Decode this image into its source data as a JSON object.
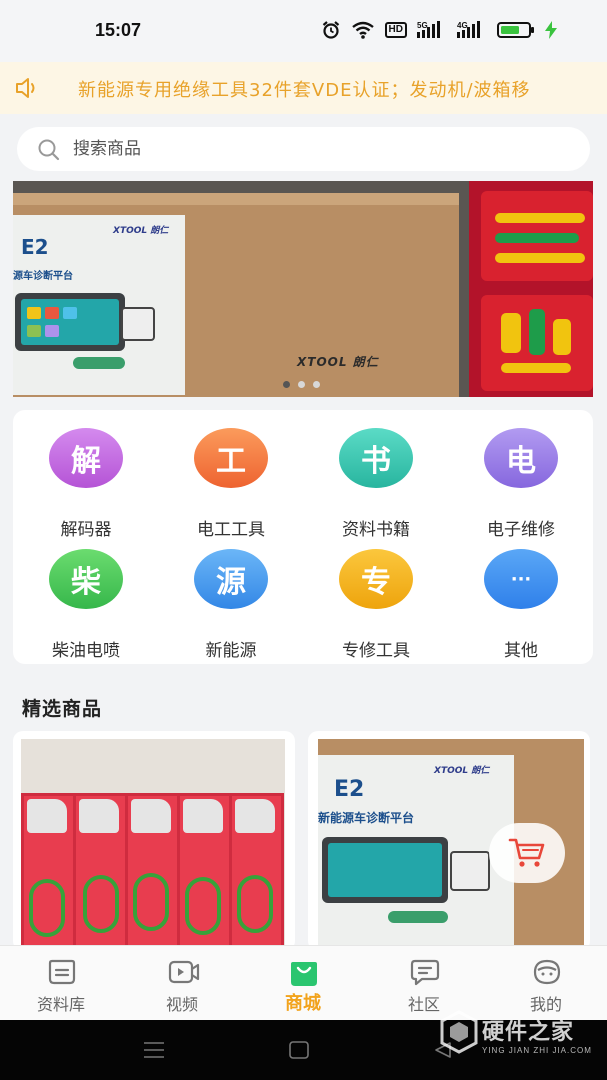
{
  "status_bar": {
    "time": "15:07",
    "icons": [
      "alarm-icon",
      "wifi-icon",
      "hd-icon",
      "signal-5g-icon",
      "signal-4g-icon",
      "battery-icon",
      "charging-icon"
    ],
    "hd_label": "HD",
    "net_5g": "5G",
    "net_4g": "4G"
  },
  "notice": {
    "icon": "speaker-icon",
    "text": "新能源专用绝缘工具32件套VDE认证；发动机/波箱移"
  },
  "search": {
    "placeholder": "搜索商品",
    "icon": "search-icon"
  },
  "banner": {
    "slides": [
      {
        "brand": "XTOOL 朗仁",
        "title": "E2",
        "subtitle": "源车诊断平台",
        "stamp": "XTOOL 朗仁"
      },
      {
        "image": "insulated-tool-case"
      }
    ],
    "active_slide": 0,
    "slide_count": 3
  },
  "categories": [
    {
      "glyph": "解",
      "label": "解码器",
      "color": "#c26de0"
    },
    {
      "glyph": "工",
      "label": "电工工具",
      "color": "#f47b45"
    },
    {
      "glyph": "书",
      "label": "资料书籍",
      "color": "#3cc7b2"
    },
    {
      "glyph": "电",
      "label": "电子维修",
      "color": "#9b7ee6"
    },
    {
      "glyph": "柴",
      "label": "柴油电喷",
      "color": "#4fcb5c"
    },
    {
      "glyph": "源",
      "label": "新能源",
      "color": "#4a9ef0"
    },
    {
      "glyph": "专",
      "label": "专修工具",
      "color": "#f5b51a"
    },
    {
      "glyph": "···",
      "label": "其他",
      "color": "#3d8ff0"
    }
  ],
  "featured": {
    "title": "精选商品",
    "products": [
      {
        "image": "test-clip-lights"
      },
      {
        "image": "xtool-e2-box",
        "title": "E2",
        "subtitle": "新能源车诊断平台",
        "brand": "XTOOL 朗仁"
      }
    ],
    "cart_icon": "shopping-cart-icon"
  },
  "tabs": [
    {
      "label": "资料库",
      "icon": "library-icon",
      "active": false
    },
    {
      "label": "视频",
      "icon": "video-icon",
      "active": false
    },
    {
      "label": "商城",
      "icon": "shop-bag-icon",
      "active": true
    },
    {
      "label": "社区",
      "icon": "chat-icon",
      "active": false
    },
    {
      "label": "我的",
      "icon": "profile-icon",
      "active": false
    }
  ],
  "colors": {
    "accent": "#f2a31c",
    "active_tab_icon": "#2ac56f",
    "notice_text": "#e8a22a",
    "notice_bg": "#fdf6e5",
    "cart_red": "#e8473a"
  },
  "watermark": {
    "text": "硬件之家",
    "sub": "YING JIAN ZHI JIA.COM"
  }
}
